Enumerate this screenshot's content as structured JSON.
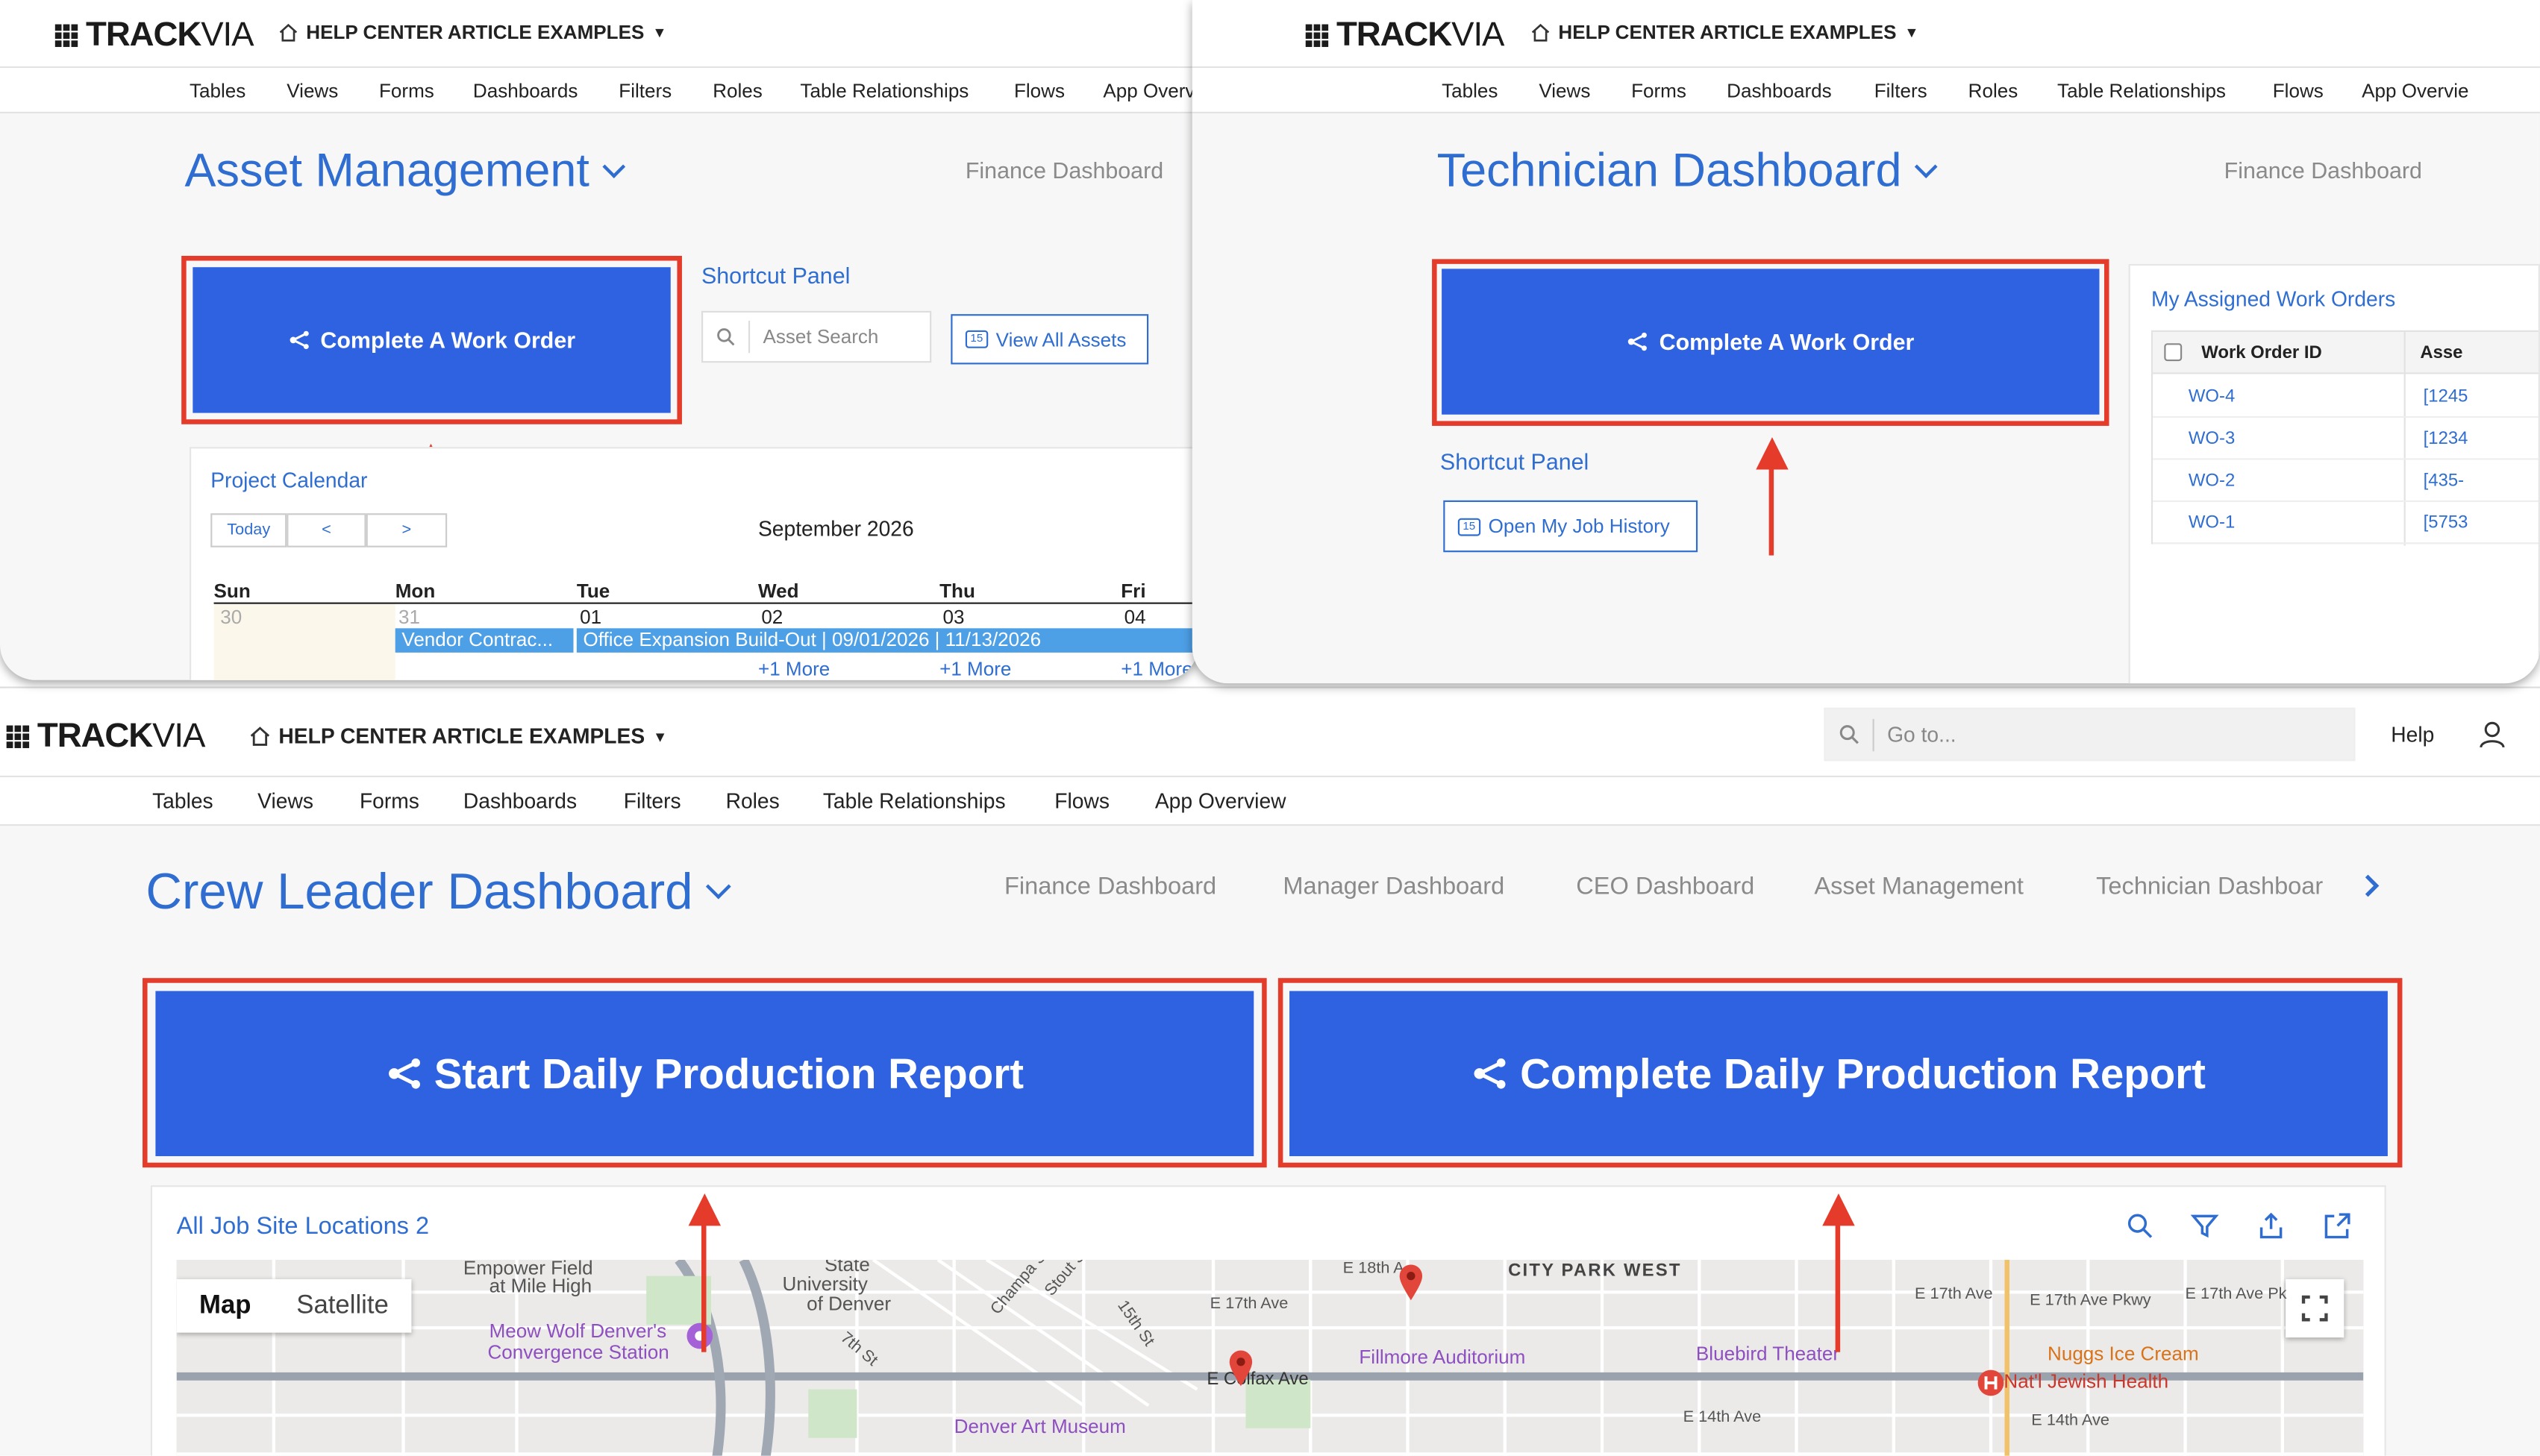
{
  "brand": {
    "name_bold": "TRACK",
    "name_thin": "VIA"
  },
  "app": {
    "name": "HELP CENTER ARTICLE EXAMPLES"
  },
  "nav": [
    "Tables",
    "Views",
    "Forms",
    "Dashboards",
    "Filters",
    "Roles",
    "Table Relationships",
    "Flows",
    "App Overview"
  ],
  "nav_truncated_tl": "App Overv",
  "nav_truncated_tr": "App Overvie",
  "top_left": {
    "title": "Asset Management",
    "finance_link": "Finance Dashboard",
    "work_order_button": "Complete A Work Order",
    "shortcut_panel": "Shortcut Panel",
    "asset_search_placeholder": "Asset Search",
    "view_all_assets": "View All Assets",
    "badge": "15",
    "calendar": {
      "title": "Project Calendar",
      "today": "Today",
      "prev": "<",
      "next": ">",
      "month": "September 2026",
      "days": [
        "Sun",
        "Mon",
        "Tue",
        "Wed",
        "Thu",
        "Fri"
      ],
      "dates": [
        "30",
        "31",
        "01",
        "02",
        "03",
        "04"
      ],
      "event1": "Vendor Contrac...",
      "event2": "Office Expansion Build-Out | 09/01/2026 | 11/13/2026",
      "more": "+1 More"
    }
  },
  "top_right": {
    "title": "Technician Dashboard",
    "finance_link": "Finance Dashboard",
    "work_order_button": "Complete A Work Order",
    "shortcut_panel": "Shortcut Panel",
    "job_history": "Open My Job History",
    "badge": "15",
    "assigned": {
      "title": "My Assigned Work Orders",
      "col1": "Work Order ID",
      "col2": "Asse",
      "rows": [
        {
          "id": "WO-4",
          "asset": "[1245"
        },
        {
          "id": "WO-3",
          "asset": "[1234"
        },
        {
          "id": "WO-2",
          "asset": "[435-"
        },
        {
          "id": "WO-1",
          "asset": "[5753"
        }
      ]
    }
  },
  "bottom": {
    "goto_placeholder": "Go to...",
    "help": "Help",
    "title": "Crew Leader Dashboard",
    "dash_links": [
      "Finance Dashboard",
      "Manager Dashboard",
      "CEO Dashboard",
      "Asset Management",
      "Technician Dashboar"
    ],
    "start_report": "Start Daily Production Report",
    "complete_report": "Complete Daily Production Report",
    "map_panel_title": "All Job Site Locations 2",
    "map_tab_map": "Map",
    "map_tab_satellite": "Satellite",
    "map_labels": {
      "empower": "Empower Field",
      "mile_high": "at Mile High",
      "university": "University",
      "state": "State",
      "of_denver": "of Denver",
      "meow_wolf": "Meow Wolf Denver's",
      "convergence": "Convergence Station",
      "city_park_west": "CITY PARK WEST",
      "fillmore": "Fillmore Auditorium",
      "bluebird": "Bluebird Theater",
      "nuggs": "Nuggs Ice Cream",
      "national_jewish": "Nat'l Jewish Health",
      "denver_art": "Denver Art Museum",
      "e_colfax": "E Colfax Ave",
      "e_17th": "E 17th Ave",
      "e_18th": "E 18th A",
      "e_17th_pkwy": "E 17th Ave Pkwy",
      "e_17th_pk": "E 17th Ave Pk",
      "e_14th": "E 14th Ave",
      "e_14th_2": "E 14th Ave",
      "champa": "Champa St",
      "stout": "Stout St",
      "st_15th": "15th St",
      "st_7th": "7th St"
    }
  },
  "colors": {
    "accent": "#2f62e0",
    "link": "#2f6ed0",
    "annotation": "#e53b2a",
    "event": "#4d9fe6"
  }
}
